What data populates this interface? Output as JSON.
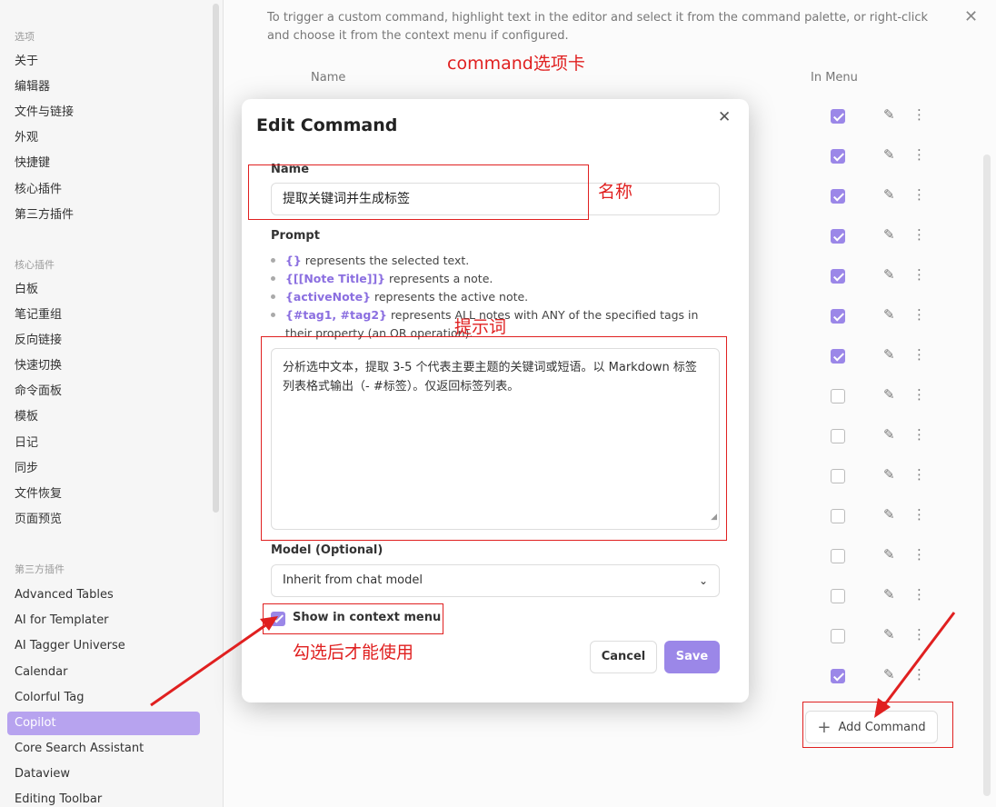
{
  "sidebar": {
    "sections": [
      {
        "heading": "选项",
        "items": [
          "关于",
          "编辑器",
          "文件与链接",
          "外观",
          "快捷键",
          "核心插件",
          "第三方插件"
        ]
      },
      {
        "heading": "核心插件",
        "items": [
          "白板",
          "笔记重组",
          "反向链接",
          "快速切换",
          "命令面板",
          "模板",
          "日记",
          "同步",
          "文件恢复",
          "页面预览"
        ]
      },
      {
        "heading": "第三方插件",
        "items": [
          "Advanced Tables",
          "AI for Templater",
          "AI Tagger Universe",
          "Calendar",
          "Colorful Tag",
          "Copilot",
          "Core Search Assistant",
          "Dataview",
          "Editing Toolbar"
        ]
      }
    ],
    "active_item": "Copilot"
  },
  "panel": {
    "description": "To trigger a custom command, highlight text in the editor and select it from the command palette, or right-click and choose it from the context menu if configured.",
    "column_name": "Name",
    "column_in_menu": "In Menu",
    "rows_in_menu": [
      true,
      true,
      true,
      true,
      true,
      true,
      true,
      false,
      false,
      false,
      false,
      false,
      false,
      false,
      true
    ],
    "add_command_label": "Add Command"
  },
  "modal": {
    "title": "Edit Command",
    "name_label": "Name",
    "name_value": "提取关键词并生成标签",
    "prompt_label": "Prompt",
    "help": [
      {
        "token": "{}",
        "text": " represents the selected text."
      },
      {
        "token": "{[[Note Title]]}",
        "text": " represents a note."
      },
      {
        "token": "{activeNote}",
        "text": " represents the active note."
      },
      {
        "token": "{#tag1, #tag2}",
        "text": " represents ALL notes with ANY of the specified tags in their property (an OR operation)."
      }
    ],
    "prompt_value": "分析选中文本，提取 3-5 个代表主要主题的关键词或短语。以 Markdown 标签列表格式输出（- #标签）。仅返回标签列表。",
    "model_label": "Model (Optional)",
    "model_value": "Inherit from chat model",
    "context_menu_label": "Show in context menu",
    "context_menu_checked": true,
    "cancel_label": "Cancel",
    "save_label": "Save"
  },
  "annotations": {
    "command_tab": "command选项卡",
    "name": "名称",
    "prompt": "提示词",
    "check_hint": "勾选后才能使用",
    "color": "#e02020"
  },
  "colors": {
    "accent": "#9b87e8",
    "annotation": "#e02020"
  }
}
